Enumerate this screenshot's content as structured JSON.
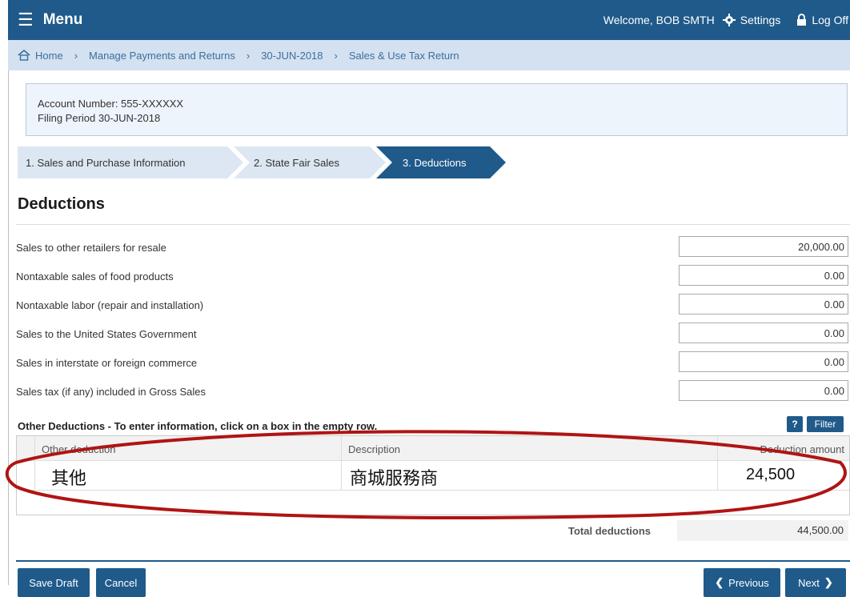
{
  "topbar": {
    "menu_label": "Menu",
    "welcome": "Welcome, BOB SMTH",
    "settings": "Settings",
    "logoff": "Log Off"
  },
  "breadcrumb": [
    "Home",
    "Manage Payments and Returns",
    "30-JUN-2018",
    "Sales & Use Tax Return"
  ],
  "account": {
    "number": "Account Number: 555-XXXXXX",
    "period": "Filing Period 30-JUN-2018"
  },
  "steps": [
    "1. Sales and Purchase Information",
    "2. State Fair Sales",
    "3. Deductions"
  ],
  "page_title": "Deductions",
  "deductions": [
    {
      "label": "Sales to other retailers for resale",
      "value": "20,000.00"
    },
    {
      "label": "Nontaxable sales of food products",
      "value": "0.00"
    },
    {
      "label": "Nontaxable labor (repair and installation)",
      "value": "0.00"
    },
    {
      "label": "Sales to the United States Government",
      "value": "0.00"
    },
    {
      "label": "Sales in interstate or foreign commerce",
      "value": "0.00"
    },
    {
      "label": "Sales tax (if any) included in Gross Sales",
      "value": "0.00"
    }
  ],
  "other": {
    "title": "Other Deductions - To enter information, click on a box in the empty row.",
    "help": "?",
    "filter": "Filter",
    "columns": [
      "Other deduction",
      "Description",
      "Deduction amount"
    ],
    "row": [
      "其他",
      "商城服務商",
      "24,500"
    ]
  },
  "totals": {
    "label": "Total deductions",
    "value": "44,500.00"
  },
  "buttons": {
    "save_draft": "Save Draft",
    "cancel": "Cancel",
    "previous": "Previous",
    "next": "Next"
  },
  "colors": {
    "primary": "#1f5a8a",
    "breadcrumb_bg": "#d4e1f0",
    "annotation": "#b01414"
  }
}
